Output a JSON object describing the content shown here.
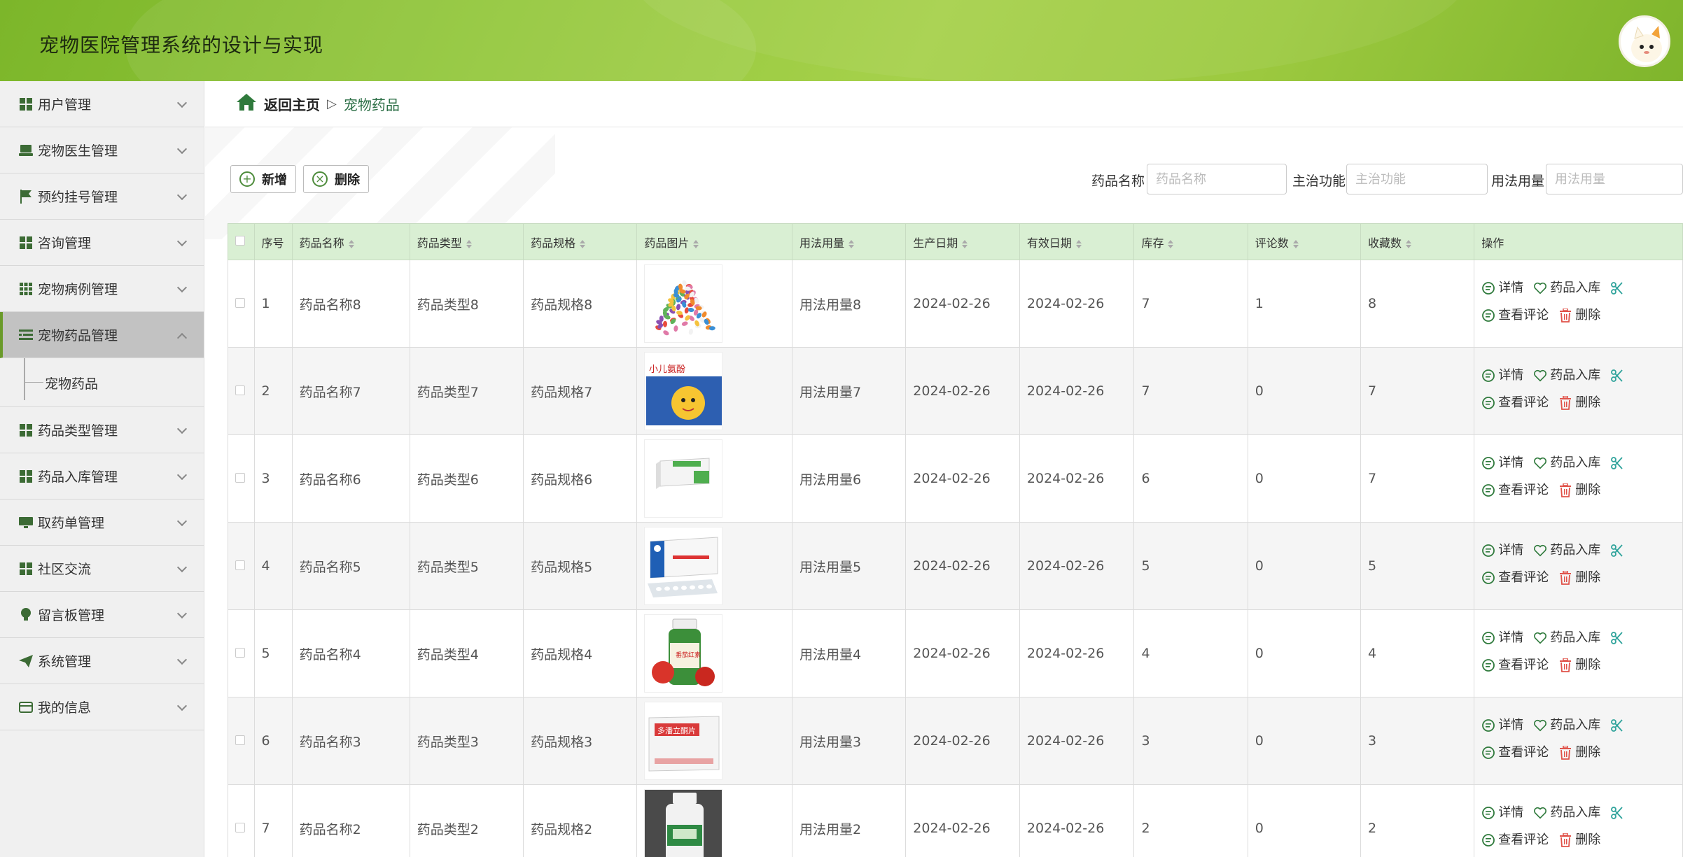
{
  "header": {
    "title": "宠物医院管理系统的设计与实现"
  },
  "sidebar": {
    "items": [
      {
        "label": "用户管理",
        "icon": "grid-icon"
      },
      {
        "label": "宠物医生管理",
        "icon": "laptop-icon"
      },
      {
        "label": "预约挂号管理",
        "icon": "flag-icon"
      },
      {
        "label": "咨询管理",
        "icon": "grid-icon"
      },
      {
        "label": "宠物病例管理",
        "icon": "apps-icon"
      },
      {
        "label": "宠物药品管理",
        "icon": "list-icon"
      },
      {
        "label": "药品类型管理",
        "icon": "grid-icon"
      },
      {
        "label": "药品入库管理",
        "icon": "grid-icon"
      },
      {
        "label": "取药单管理",
        "icon": "monitor-icon"
      },
      {
        "label": "社区交流",
        "icon": "grid-icon"
      },
      {
        "label": "留言板管理",
        "icon": "bulb-icon"
      },
      {
        "label": "系统管理",
        "icon": "send-icon"
      },
      {
        "label": "我的信息",
        "icon": "card-icon"
      }
    ],
    "submenu": "宠物药品"
  },
  "breadcrumb": {
    "home": "返回主页",
    "separator": "▷",
    "current": "宠物药品"
  },
  "toolbar": {
    "add": "新增",
    "delete": "删除"
  },
  "filters": [
    {
      "label": "药品名称",
      "placeholder": "药品名称"
    },
    {
      "label": "主治功能",
      "placeholder": "主治功能"
    },
    {
      "label": "用法用量",
      "placeholder": "用法用量"
    }
  ],
  "table": {
    "columns": [
      "序号",
      "药品名称",
      "药品类型",
      "药品规格",
      "药品图片",
      "用法用量",
      "生产日期",
      "有效日期",
      "库存",
      "评论数",
      "收藏数",
      "操作"
    ],
    "rows": [
      {
        "no": "1",
        "name": "药品名称8",
        "type": "药品类型8",
        "spec": "药品规格8",
        "usage": "用法用量8",
        "prod": "2024-02-26",
        "exp": "2024-02-26",
        "stock": "7",
        "comments": "1",
        "favs": "8"
      },
      {
        "no": "2",
        "name": "药品名称7",
        "type": "药品类型7",
        "spec": "药品规格7",
        "usage": "用法用量7",
        "prod": "2024-02-26",
        "exp": "2024-02-26",
        "stock": "7",
        "comments": "0",
        "favs": "7"
      },
      {
        "no": "3",
        "name": "药品名称6",
        "type": "药品类型6",
        "spec": "药品规格6",
        "usage": "用法用量6",
        "prod": "2024-02-26",
        "exp": "2024-02-26",
        "stock": "6",
        "comments": "0",
        "favs": "7"
      },
      {
        "no": "4",
        "name": "药品名称5",
        "type": "药品类型5",
        "spec": "药品规格5",
        "usage": "用法用量5",
        "prod": "2024-02-26",
        "exp": "2024-02-26",
        "stock": "5",
        "comments": "0",
        "favs": "5"
      },
      {
        "no": "5",
        "name": "药品名称4",
        "type": "药品类型4",
        "spec": "药品规格4",
        "usage": "用法用量4",
        "prod": "2024-02-26",
        "exp": "2024-02-26",
        "stock": "4",
        "comments": "0",
        "favs": "4"
      },
      {
        "no": "6",
        "name": "药品名称3",
        "type": "药品类型3",
        "spec": "药品规格3",
        "usage": "用法用量3",
        "prod": "2024-02-26",
        "exp": "2024-02-26",
        "stock": "3",
        "comments": "0",
        "favs": "3"
      },
      {
        "no": "7",
        "name": "药品名称2",
        "type": "药品类型2",
        "spec": "药品规格2",
        "usage": "用法用量2",
        "prod": "2024-02-26",
        "exp": "2024-02-26",
        "stock": "2",
        "comments": "0",
        "favs": "2"
      }
    ],
    "row_images": [
      "pills-pile-image",
      "box-yellow-cartoon-image",
      "box-green-white-image",
      "box-blue-blister-image",
      "bottle-tomato-image",
      "box-white-red-image",
      "bottle-green-image"
    ],
    "actions": {
      "detail": "详情",
      "stock_in": "药品入库",
      "comments": "查看评论",
      "delete": "删除"
    }
  },
  "colors": {
    "header_green": "#93c73b",
    "table_header": "#d9efd3",
    "icon_green": "#4c8b3a",
    "delete_red": "#e0534a",
    "link_green": "#2b6e45"
  }
}
